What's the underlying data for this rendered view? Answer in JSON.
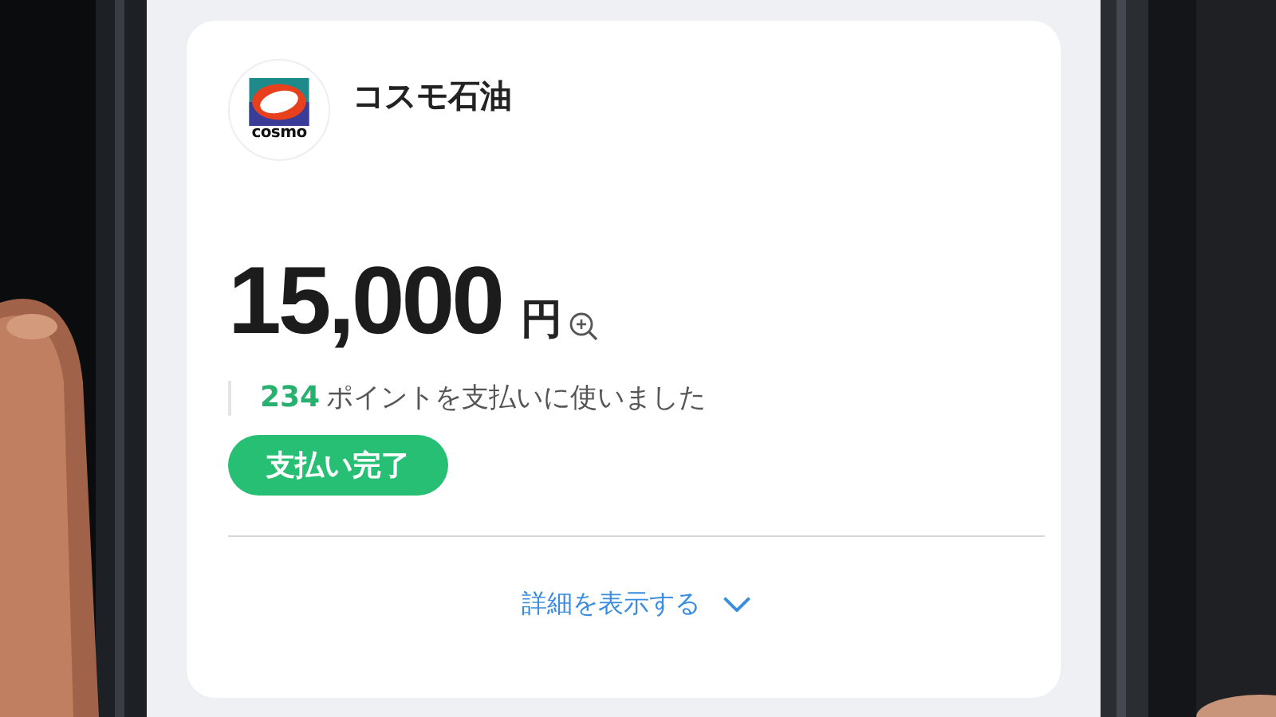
{
  "merchant": {
    "name": "コスモ石油",
    "logo_text": "cosmo"
  },
  "amount": {
    "value": "15,000",
    "unit": "円"
  },
  "points": {
    "value": "234",
    "text": "ポイントを支払いに使いました"
  },
  "status": {
    "label": "支払い完了"
  },
  "details_link": {
    "label": "詳細を表示する"
  }
}
